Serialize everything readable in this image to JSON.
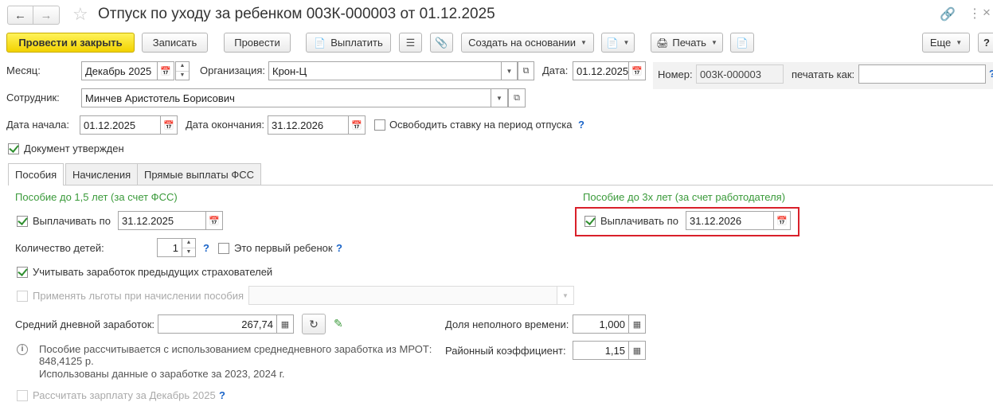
{
  "window": {
    "title": "Отпуск по уходу за ребенком 003К-000003 от 01.12.2025"
  },
  "toolbar": {
    "post_close": "Провести и закрыть",
    "save": "Записать",
    "post": "Провести",
    "pay": "Выплатить",
    "create_based": "Создать на основании",
    "print": "Печать",
    "more": "Еще",
    "help": "?"
  },
  "header": {
    "month_label": "Месяц:",
    "month_value": "Декабрь 2025",
    "org_label": "Организация:",
    "org_value": "Крон-Ц",
    "date_label": "Дата:",
    "date_value": "01.12.2025",
    "number_label": "Номер:",
    "number_value": "003К-000003",
    "print_as_label": "печатать как:",
    "print_as_value": "",
    "employee_label": "Сотрудник:",
    "employee_value": "Минчев Аристотель Борисович",
    "start_label": "Дата начала:",
    "start_value": "01.12.2025",
    "end_label": "Дата окончания:",
    "end_value": "31.12.2026",
    "free_rate_label": "Освободить ставку на период отпуска",
    "approved_label": "Документ утвержден"
  },
  "tabs": [
    {
      "label": "Пособия"
    },
    {
      "label": "Начисления"
    },
    {
      "label": "Прямые выплаты ФСС"
    }
  ],
  "benefits": {
    "section1_title": "Пособие до 1,5 лет (за счет ФСС)",
    "section2_title": "Пособие до 3х лет (за счет работодателя)",
    "pay_until_label": "Выплачивать по",
    "pay_until_1": "31.12.2025",
    "pay_until_2": "31.12.2026",
    "children_label": "Количество детей:",
    "children_value": "1",
    "first_child_label": "Это первый ребенок",
    "prev_insurers_label": "Учитывать заработок предыдущих страхователей",
    "apply_benefits_label": "Применять льготы при начислении пособия",
    "avg_daily_label": "Средний дневной заработок:",
    "avg_daily_value": "267,74",
    "part_time_label": "Доля неполного времени:",
    "part_time_value": "1,000",
    "district_coef_label": "Районный коэффициент:",
    "district_coef_value": "1,15",
    "info_line1": "Пособие рассчитывается с использованием среднедневного заработка из МРОТ:",
    "info_line2": "848,4125 р.",
    "info_line3": "Использованы данные о заработке за  2023,  2024 г.",
    "calc_salary_label": "Рассчитать зарплату за Декабрь 2025"
  },
  "colors": {
    "primary_button": "#f2d200",
    "highlight_border": "#d9202a",
    "section_title": "#3a9a3a",
    "help": "#1a64c8"
  }
}
